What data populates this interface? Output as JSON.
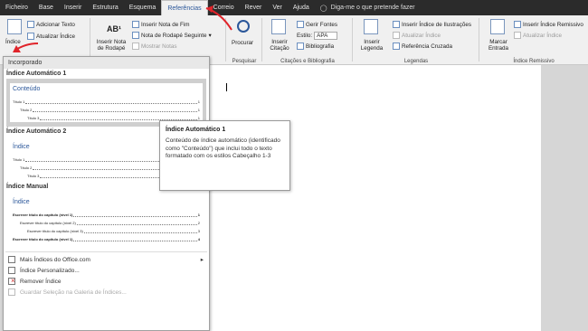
{
  "tabs": [
    "Ficheiro",
    "Base",
    "Inserir",
    "Estrutura",
    "Esquema",
    "Referências",
    "Correio",
    "Rever",
    "Ver",
    "Ajuda"
  ],
  "active_tab": "Referências",
  "tell_me": "Diga-me o que pretende fazer",
  "ribbon": {
    "indice": "Índice",
    "adicionar_texto": "Adicionar Texto",
    "atualizar_indice": "Atualizar Índice",
    "inserir_nota": "Inserir Nota de Rodapé",
    "inserir_nota_fim": "Inserir Nota de Fim",
    "nota_seguinte": "Nota de Rodapé Seguinte",
    "mostrar_notas": "Mostrar Notas",
    "notas_rodape": "Notas de Rodapé",
    "procurar": "Procurar",
    "pesquisar": "Pesquisar",
    "inserir_citacao": "Inserir Citação",
    "gerir_fontes": "Gerir Fontes",
    "estilo_label": "Estilo:",
    "estilo_value": "APA",
    "bibliografia": "Bibliografia",
    "citacoes": "Citações e Bibliografia",
    "inserir_legenda": "Inserir Legenda",
    "inserir_indice_ilustracoes": "Inserir Índice de Ilustrações",
    "atualizar_indice_ilus": "Atualizar Índice",
    "referencia_cruzada": "Referência Cruzada",
    "legendas": "Legendas",
    "marcar_entrada": "Marcar Entrada",
    "inserir_indice_remissivo": "Inserir Índice Remissivo",
    "atualizar_indice_rem": "Atualizar Índice",
    "indice_remissivo": "Índice Remissivo",
    "ab_icon": "AB¹"
  },
  "gallery": {
    "header": "Incorporado",
    "sections": [
      {
        "name": "Índice Automático 1",
        "title": "Conteúdo",
        "lines": [
          {
            "text": "Título 1",
            "page": "1",
            "level": 1
          },
          {
            "text": "Título 2",
            "page": "1",
            "level": 2
          },
          {
            "text": "Título 3",
            "page": "1",
            "level": 3
          }
        ]
      },
      {
        "name": "Índice Automático 2",
        "title": "Índice",
        "lines": [
          {
            "text": "Título 1",
            "page": "1",
            "level": 1
          },
          {
            "text": "Título 2",
            "page": "1",
            "level": 2
          },
          {
            "text": "Título 3",
            "page": "1",
            "level": 3
          }
        ]
      },
      {
        "name": "Índice Manual",
        "title": "Índice",
        "lines": [
          {
            "text": "Escrever título do capítulo (nível 1)",
            "page": "1",
            "level": 1
          },
          {
            "text": "Escrever título do capítulo (nível 2)",
            "page": "2",
            "level": 2
          },
          {
            "text": "Escrever título do capítulo (nível 3)",
            "page": "3",
            "level": 3
          },
          {
            "text": "Escrever título do capítulo (nível 1)",
            "page": "4",
            "level": 1
          }
        ]
      }
    ],
    "menu": [
      {
        "label": "Mais Índices do Office.com",
        "enabled": true
      },
      {
        "label": "Índice Personalizado...",
        "enabled": true
      },
      {
        "label": "Remover Índice",
        "enabled": true
      },
      {
        "label": "Guardar Seleção na Galeria de Índices...",
        "enabled": false
      }
    ]
  },
  "tooltip": {
    "title": "Índice Automático 1",
    "body": "Conteúdo de índice automático (identificado como \"Conteúdo\") que inclui todo o texto formatado com os estilos Cabeçalho 1-3"
  },
  "colors": {
    "accent": "#2b579a",
    "annotation": "#e0242a"
  }
}
